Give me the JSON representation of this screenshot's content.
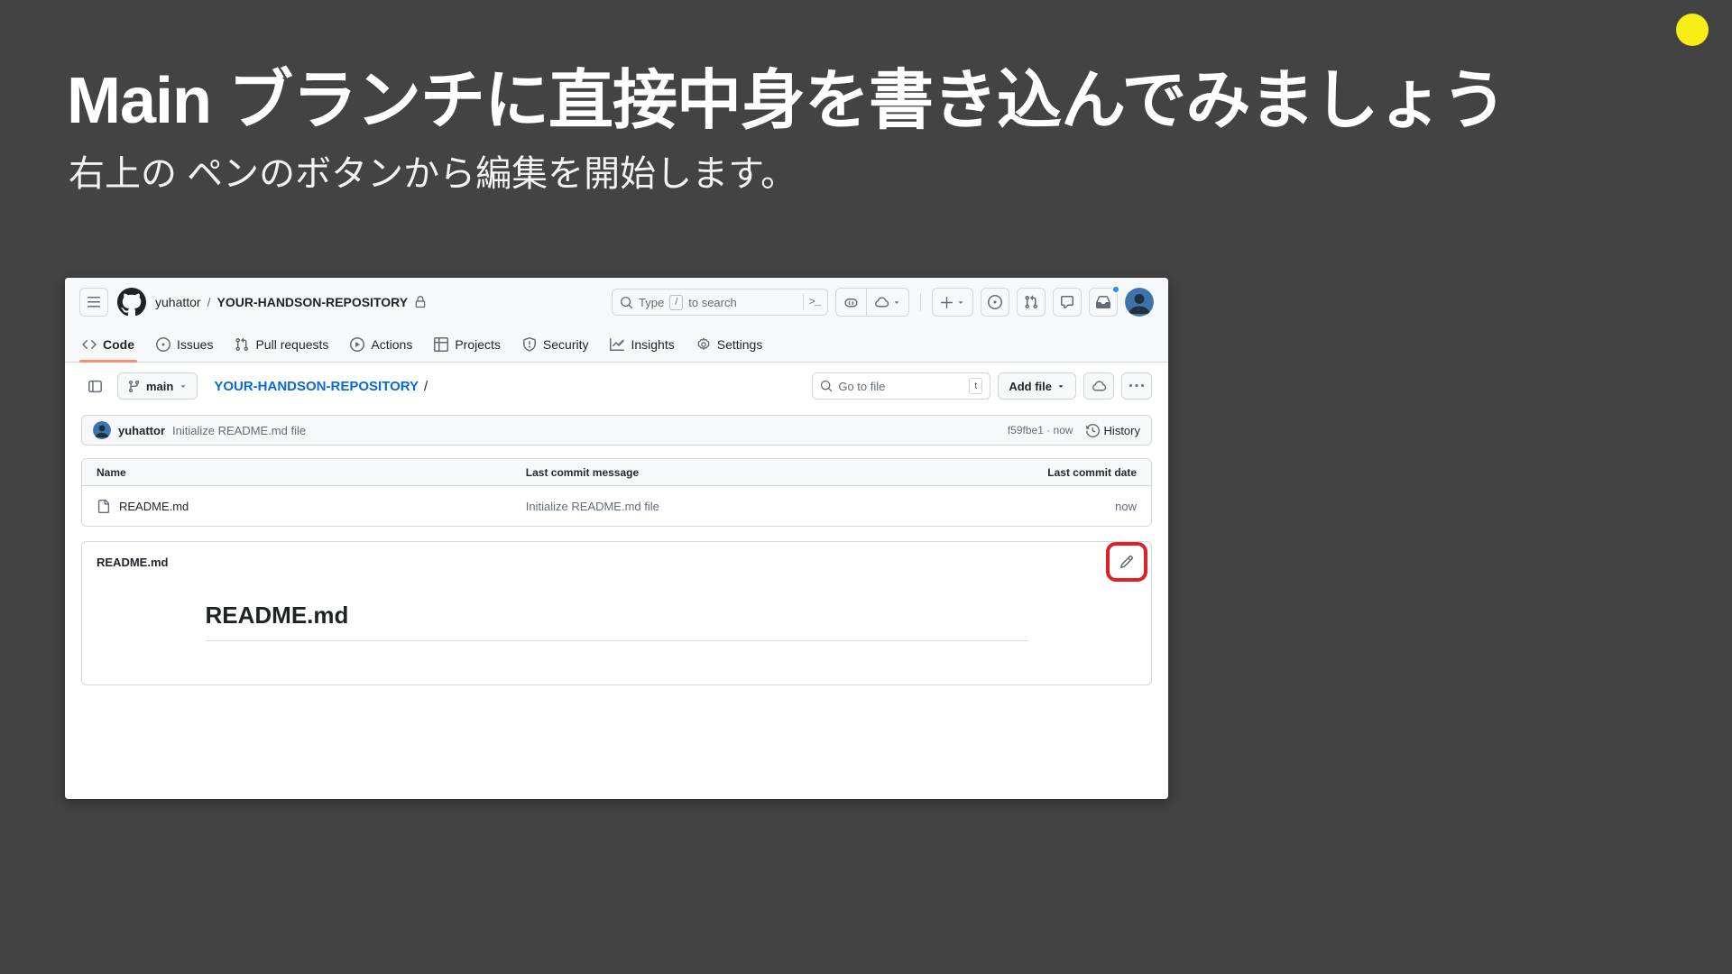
{
  "slide": {
    "title": "Main ブランチに直接中身を書き込んでみましょう",
    "subtitle": "右上の ペンのボタンから編集を開始します。"
  },
  "colors": {
    "slide_background": "#434343",
    "marker_yellow": "#f8ee17",
    "annotation_red": "#e01f26",
    "link_blue": "#0969da",
    "active_tab_underline": "#fd8c73"
  },
  "header": {
    "owner": "yuhattor",
    "separator": "/",
    "repo": "YOUR-HANDSON-REPOSITORY",
    "search": {
      "prefix": "Type",
      "shortcut_key": "/",
      "suffix": "to search",
      "terminal_glyph": ">_"
    }
  },
  "nav": {
    "tabs": [
      {
        "label": "Code",
        "active": true
      },
      {
        "label": "Issues"
      },
      {
        "label": "Pull requests"
      },
      {
        "label": "Actions"
      },
      {
        "label": "Projects"
      },
      {
        "label": "Security"
      },
      {
        "label": "Insights"
      },
      {
        "label": "Settings"
      }
    ]
  },
  "toolbar": {
    "branch": "main",
    "repo_link": "YOUR-HANDSON-REPOSITORY",
    "path_separator": "/",
    "goto_file_placeholder": "Go to file",
    "goto_file_shortcut": "t",
    "add_file_label": "Add file"
  },
  "commit": {
    "author": "yuhattor",
    "message": "Initialize README.md file",
    "sha_and_time": "f59fbe1 · now",
    "history_label": "History"
  },
  "files": {
    "columns": {
      "name": "Name",
      "message": "Last commit message",
      "date": "Last commit date"
    },
    "rows": [
      {
        "name": "README.md",
        "message": "Initialize README.md file",
        "date": "now"
      }
    ]
  },
  "readme": {
    "bar_title": "README.md",
    "heading": "README.md"
  }
}
